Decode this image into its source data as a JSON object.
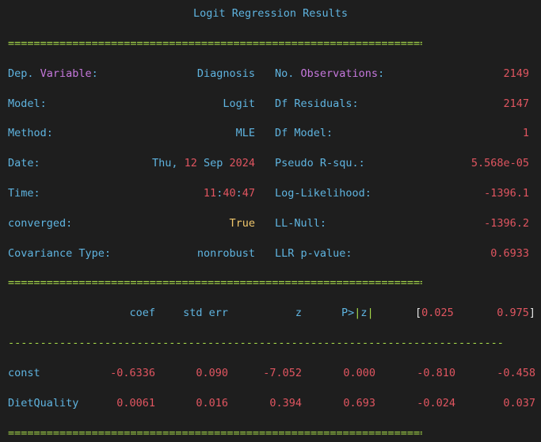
{
  "title": "Logit Regression Results",
  "rule_eq": "============================================================================",
  "rule_dash": "-----------------------------------------------------------------------------",
  "left": [
    {
      "label_pre": "Dep. ",
      "label_hl": "Variable",
      "label_post": ":",
      "value": "Diagnosis"
    },
    {
      "label_pre": "Model:",
      "label_hl": "",
      "label_post": "",
      "value": "Logit"
    },
    {
      "label_pre": "Method:",
      "label_hl": "",
      "label_post": "",
      "value": "MLE"
    },
    {
      "label_pre": "Date:",
      "label_hl": "",
      "label_post": "",
      "value_parts": [
        "Thu, ",
        "12",
        " Sep ",
        "2024"
      ]
    },
    {
      "label_pre": "Time:",
      "label_hl": "",
      "label_post": "",
      "value_parts": [
        "11",
        ":",
        "40",
        ":",
        "47"
      ]
    },
    {
      "label_pre": "converged:",
      "label_hl": "",
      "label_post": "",
      "value": "True"
    },
    {
      "label_pre": "Covariance Type:",
      "label_hl": "",
      "label_post": "",
      "value": "nonrobust"
    }
  ],
  "right": [
    {
      "label_pre": "No. ",
      "label_hl": "Observations",
      "label_post": ":",
      "value": "2149"
    },
    {
      "label_pre": "Df Residuals:",
      "label_hl": "",
      "label_post": "",
      "value": "2147"
    },
    {
      "label_pre": "Df Model:",
      "label_hl": "",
      "label_post": "",
      "value": "1"
    },
    {
      "label_pre": "Pseudo R-squ.:",
      "label_hl": "",
      "label_post": "",
      "value": "5.568e-05"
    },
    {
      "label_pre": "Log-Likelihood:",
      "label_hl": "",
      "label_post": "",
      "value": "-1396.1"
    },
    {
      "label_pre": "LL-Null:",
      "label_hl": "",
      "label_post": "",
      "value": "-1396.2"
    },
    {
      "label_pre": "LLR p-value:",
      "label_hl": "",
      "label_post": "",
      "value": "0.6933"
    }
  ],
  "coef_header": {
    "coef": "coef",
    "stderr": "std err",
    "z": "z",
    "p_pre": "P>",
    "p_bar": "|",
    "p_z": "z",
    "p_bar2": "|",
    "ci_lo_br": "[",
    "ci_lo": "0.025",
    "ci_hi": "0.975",
    "ci_hi_br": "]"
  },
  "coef_rows": [
    {
      "name": "const",
      "coef": "-0.6336",
      "stderr": "0.090",
      "z": "-7.052",
      "p": "0.000",
      "lo": "-0.810",
      "hi": "-0.458"
    },
    {
      "name": "DietQuality",
      "coef": "0.0061",
      "stderr": "0.016",
      "z": "0.394",
      "p": "0.693",
      "lo": "-0.024",
      "hi": "0.037"
    }
  ]
}
